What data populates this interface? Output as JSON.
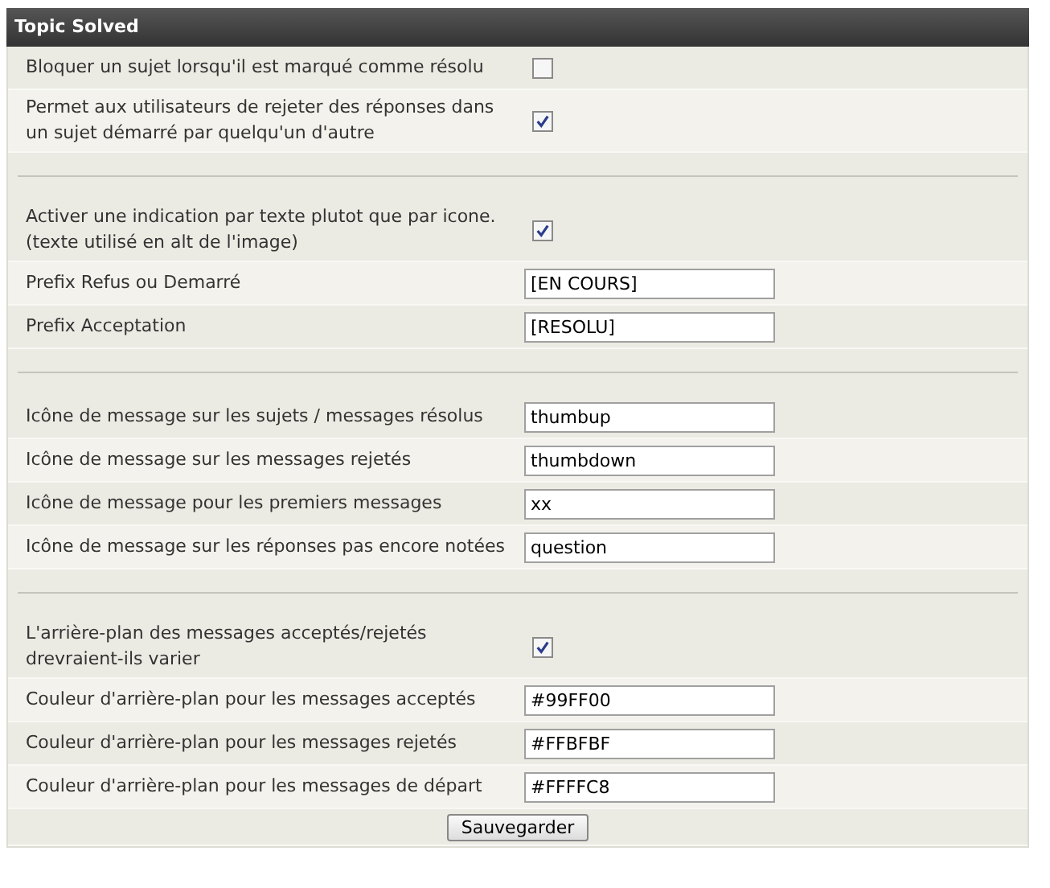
{
  "title": "Topic Solved",
  "sections": [
    {
      "rows": [
        {
          "kind": "checkbox",
          "label": "Bloquer un sujet lorsqu'il est marqué comme résolu",
          "checked": false
        },
        {
          "kind": "checkbox",
          "label": "Permet aux utilisateurs de rejeter des réponses dans un sujet démarré par quelqu'un d'autre",
          "checked": true
        }
      ]
    },
    {
      "rows": [
        {
          "kind": "checkbox",
          "label": "Activer une indication par texte plutot que par icone. (texte utilisé en alt de l'image)",
          "checked": true
        },
        {
          "kind": "text",
          "label": "Prefix Refus ou Demarré",
          "value": "[EN COURS]"
        },
        {
          "kind": "text",
          "label": "Prefix Acceptation",
          "value": "[RESOLU]"
        }
      ]
    },
    {
      "rows": [
        {
          "kind": "text",
          "label": "Icône de message sur les sujets / messages résolus",
          "value": "thumbup"
        },
        {
          "kind": "text",
          "label": "Icône de message sur les messages rejetés",
          "value": "thumbdown"
        },
        {
          "kind": "text",
          "label": "Icône de message pour les premiers messages",
          "value": "xx"
        },
        {
          "kind": "text",
          "label": "Icône de message sur les réponses pas encore notées",
          "value": "question"
        }
      ]
    },
    {
      "rows": [
        {
          "kind": "checkbox",
          "label": "L'arrière-plan des messages acceptés/rejetés drevraient-ils varier",
          "checked": true
        },
        {
          "kind": "text",
          "label": "Couleur d'arrière-plan pour les messages acceptés",
          "value": "#99FF00"
        },
        {
          "kind": "text",
          "label": "Couleur d'arrière-plan pour les messages rejetés",
          "value": "#FFBFBF"
        },
        {
          "kind": "text",
          "label": "Couleur d'arrière-plan pour les messages de départ",
          "value": "#FFFFC8"
        }
      ]
    }
  ],
  "save_button": "Sauvegarder"
}
